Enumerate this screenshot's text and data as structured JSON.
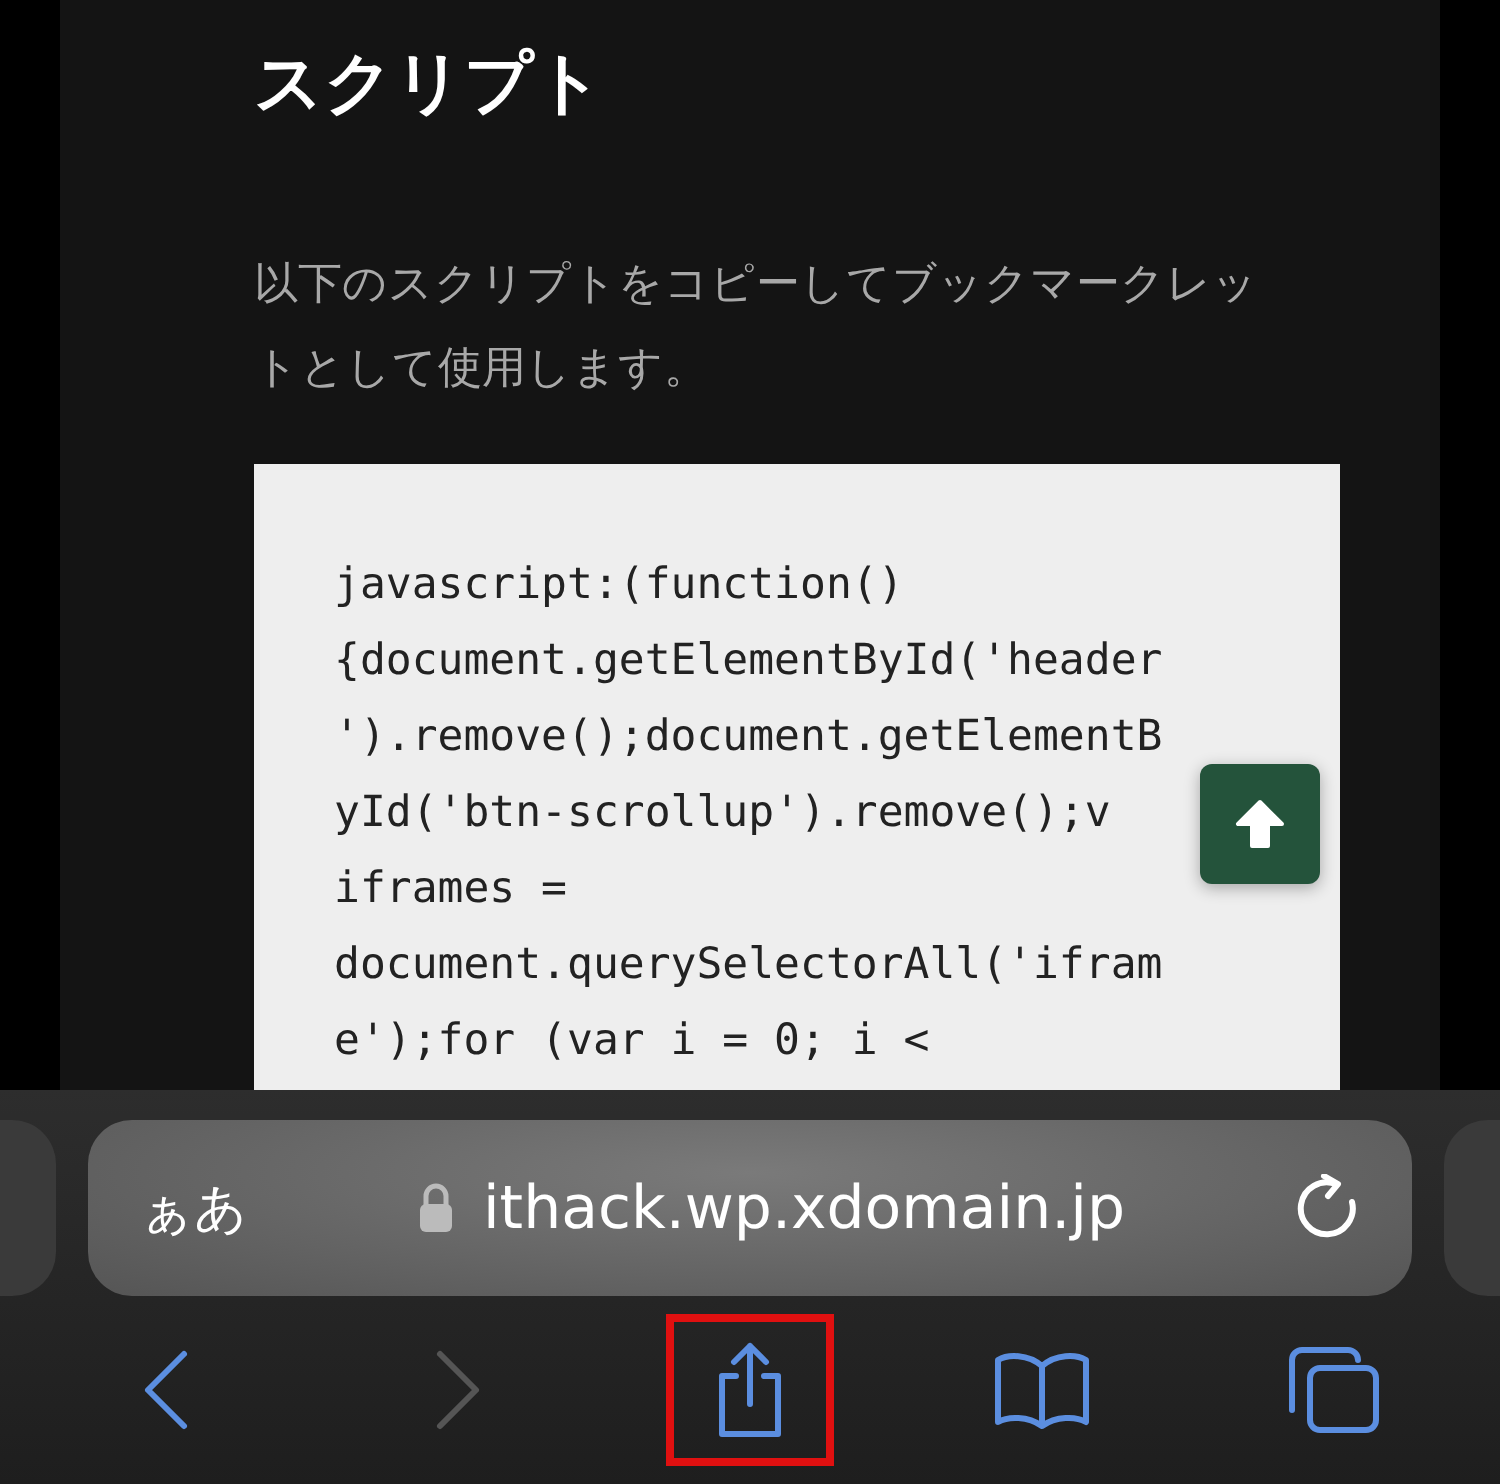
{
  "article": {
    "heading": "スクリプト",
    "paragraph": "以下のスクリプトをコピーしてブックマークレットとして使用します。",
    "code_lines": [
      "javascript:(function()",
      "{document.getElementById('header",
      "').remove();document.getElementB",
      "yId('btn-scrollup').remove();v",
      "iframes =",
      "document.querySelectorAll('ifram",
      "e');for (var i = 0; i <"
    ]
  },
  "address_bar": {
    "format_label": "ぁあ",
    "url": "ithack.wp.xdomain.jp",
    "secure": true
  },
  "toolbar": [
    {
      "kind": "back",
      "disabled": false,
      "highlighted": false
    },
    {
      "kind": "forward",
      "disabled": true,
      "highlighted": false
    },
    {
      "kind": "share",
      "disabled": false,
      "highlighted": true
    },
    {
      "kind": "bookmarks",
      "disabled": false,
      "highlighted": false
    },
    {
      "kind": "tabs",
      "disabled": false,
      "highlighted": false
    }
  ]
}
